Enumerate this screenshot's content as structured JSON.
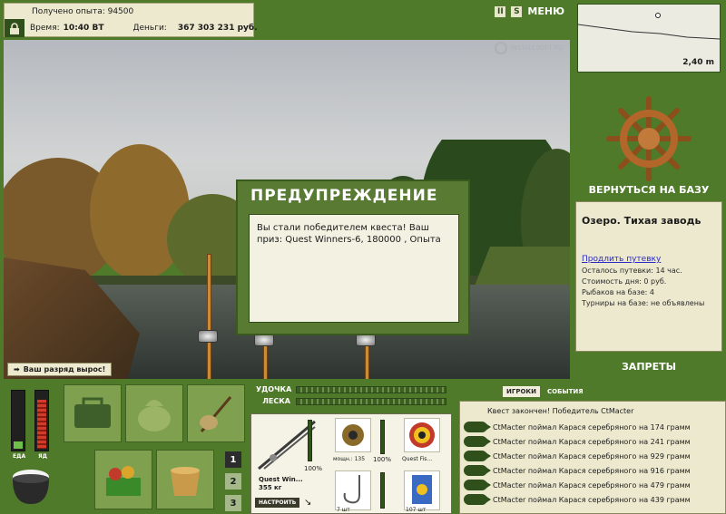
{
  "stats": {
    "xp": "Получено опыта: 94500",
    "time_label": "Время:",
    "time_value": "10:40 ВТ",
    "money_label": "Деньги:",
    "money_value": "367 303 231 руб."
  },
  "top_controls": {
    "pause_icon": "pause-icon",
    "settings_icon": "s-icon",
    "menu_label": "МЕНЮ"
  },
  "watermark": "INSTALLSOFT.RU",
  "rank_notice": "Ваш разряд вырос!",
  "dialog": {
    "title": "ПРЕДУПРЕЖДЕНИЕ",
    "message": "Вы стали победителем квеста! Ваш приз: Quest Winners-6, 180000 , Опыта"
  },
  "depth": {
    "value": "2,40 m"
  },
  "base": {
    "return_label": "ВЕРНУТЬСЯ НА БАЗУ",
    "location": "Озеро. Тихая заводь",
    "extend_link": "Продлить путевку",
    "info": [
      "Осталось путевки: 14 час.",
      "Стоимость дня: 0 руб.",
      "Рыбаков на базе: 4",
      "Турниры на базе: не объявлены"
    ],
    "bans_label": "ЗАПРЕТЫ"
  },
  "needs": {
    "food_label": "ЕДА",
    "poison_label": "ЯД",
    "food_level": 0.12,
    "poison_level": 0.85
  },
  "inventory": {
    "pages": [
      "1",
      "2",
      "3"
    ],
    "active_page": "1"
  },
  "tackle": {
    "rod_label": "УДОЧКА",
    "line_label": "ЛЕСКА",
    "rod_name": "Quest Win...",
    "rod_weight": "355 кг",
    "rod_percent": "100%",
    "setup_label": "НАСТРОИТЬ",
    "reel_label": "мощн.: 135",
    "reel_percent": "100%",
    "line_item": "Quest Fis...",
    "hook_count": "7 шт",
    "bait_count": "107 шт"
  },
  "events": {
    "tabs": [
      "ИГРОКИ",
      "СОБЫТИЯ"
    ],
    "quest_finished": "Квест закончен! Победитель CtMacter",
    "rows": [
      "CtMacter поймал Карася серебряного на 174 грамм",
      "CtMacter поймал Карася серебряного на 241 грамм",
      "CtMacter поймал Карася серебряного на 929 грамм",
      "CtMacter поймал Карася серебряного на 916 грамм",
      "CtMacter поймал Карася серебряного на 479 грамм",
      "CtMacter поймал Карася серебряного на 439 грамм"
    ]
  },
  "colors": {
    "panel_green": "#4f7a2a",
    "panel_cream": "#ece9cf"
  }
}
